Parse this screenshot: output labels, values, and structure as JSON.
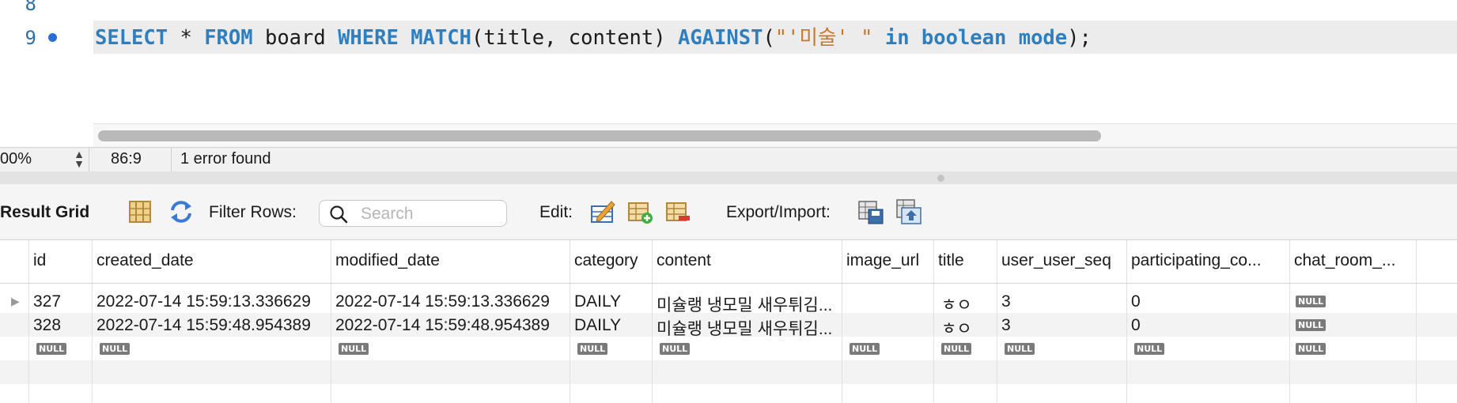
{
  "editor": {
    "line_numbers": [
      "8",
      "9"
    ],
    "code": {
      "kw1": "SELECT",
      "op1": " * ",
      "kw2": "FROM",
      "pl1": " board ",
      "kw3": "WHERE",
      "pl2": " ",
      "kw4": "MATCH",
      "pl3": "(title, content) ",
      "kw5": "AGAINST",
      "pl4": "(",
      "str": "\"'미술' \"",
      "pl5": " ",
      "kw6": "in boolean mode",
      "pl6": ");"
    }
  },
  "status": {
    "zoom": "00%",
    "cursor": "86:9",
    "message": "1 error found"
  },
  "toolbar": {
    "title": "Result Grid",
    "filter_label": "Filter Rows:",
    "search_placeholder": "Search",
    "edit_label": "Edit:",
    "export_label": "Export/Import:"
  },
  "grid": {
    "columns": [
      "id",
      "created_date",
      "modified_date",
      "category",
      "content",
      "image_url",
      "title",
      "user_user_seq",
      "participating_co...",
      "chat_room_..."
    ],
    "rows": [
      [
        "327",
        "2022-07-14 15:59:13.336629",
        "2022-07-14 15:59:13.336629",
        "DAILY",
        "미슐랭 냉모밀 새우튀김...",
        "",
        "ㅎㅇ",
        "3",
        "0",
        "NULL"
      ],
      [
        "328",
        "2022-07-14 15:59:48.954389",
        "2022-07-14 15:59:48.954389",
        "DAILY",
        "미슐랭 냉모밀 새우튀김...",
        "",
        "ㅎㅇ",
        "3",
        "0",
        "NULL"
      ],
      [
        "NULL",
        "NULL",
        "NULL",
        "NULL",
        "NULL",
        "NULL",
        "NULL",
        "NULL",
        "NULL",
        "NULL"
      ]
    ]
  },
  "colors": {
    "keyword": "#2e7fc0",
    "string": "#c8782a",
    "line_number": "#2f6fa3",
    "breakpoint": "#2a6fd8"
  }
}
